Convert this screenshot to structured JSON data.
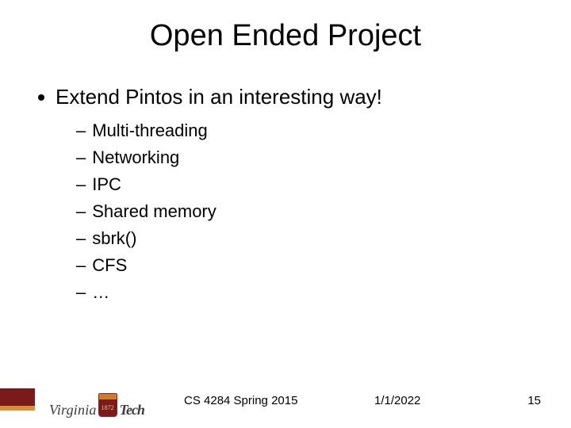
{
  "title": "Open Ended Project",
  "bullet": "Extend Pintos in an interesting way!",
  "subitems": [
    "Multi-threading",
    "Networking",
    "IPC",
    "Shared memory",
    "sbrk()",
    "CFS",
    "…"
  ],
  "logo": {
    "left": "Virginia",
    "right": "Tech",
    "year": "1872"
  },
  "footer": {
    "course": "CS 4284 Spring 2015",
    "date": "1/1/2022",
    "page": "15"
  }
}
